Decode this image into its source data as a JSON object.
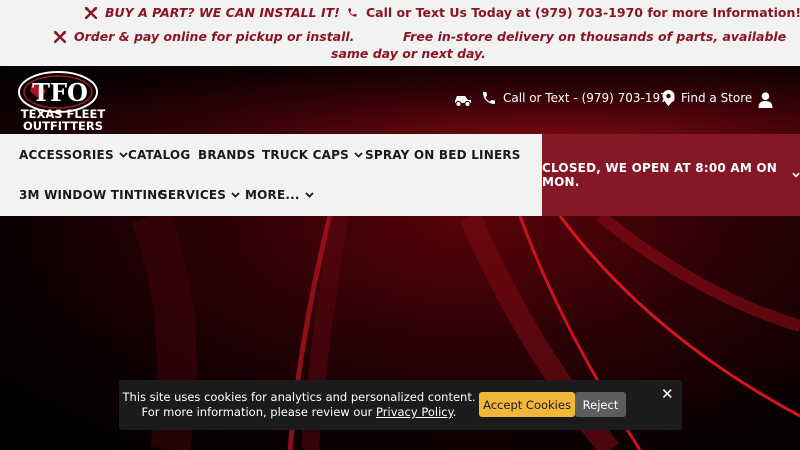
{
  "promo": {
    "line1_left": "BUY A PART? WE CAN INSTALL IT!",
    "line1_right": "Call or Text Us Today at (979) 703-1970 for more Information!",
    "line2_left": "Order & pay online for pickup or install.",
    "line2_right_a": "Free in-store delivery on thousands of parts, available",
    "line2_right_b": "same day or next day.",
    "color": "#8a1526",
    "icons": [
      "tools-icon",
      "phone-icon"
    ]
  },
  "header": {
    "logo_text": "TFO",
    "logo_subtext_top": "TEXAS FLEET",
    "logo_subtext_bottom": "OUTFITTERS",
    "call_label": "Call or Text - (979) 703-1970",
    "store_label": "Find a Store",
    "icons": [
      "vehicle-icon",
      "phone-icon",
      "map-pin-icon",
      "user-icon"
    ]
  },
  "nav": {
    "items": [
      {
        "label": "ACCESSORIES",
        "dropdown": true
      },
      {
        "label": "CATALOG",
        "dropdown": false
      },
      {
        "label": "BRANDS",
        "dropdown": false
      },
      {
        "label": "TRUCK CAPS",
        "dropdown": true
      },
      {
        "label": "SPRAY ON BED LINERS",
        "dropdown": false
      },
      {
        "label": "3M WINDOW TINTING",
        "dropdown": false
      },
      {
        "label": "SERVICES",
        "dropdown": true
      },
      {
        "label": "MORE...",
        "dropdown": true
      }
    ],
    "status": "CLOSED, WE OPEN AT 8:00 AM ON MON.",
    "status_color": "#851826"
  },
  "cookie": {
    "line1": "This site uses cookies for analytics and personalized content.",
    "line2_prefix": "For more information, please review our ",
    "link": "Privacy Policy",
    "line2_suffix": ".",
    "accept": "Accept Cookies",
    "reject": "Reject",
    "close": "✕",
    "accept_color": "#f0b73a"
  }
}
